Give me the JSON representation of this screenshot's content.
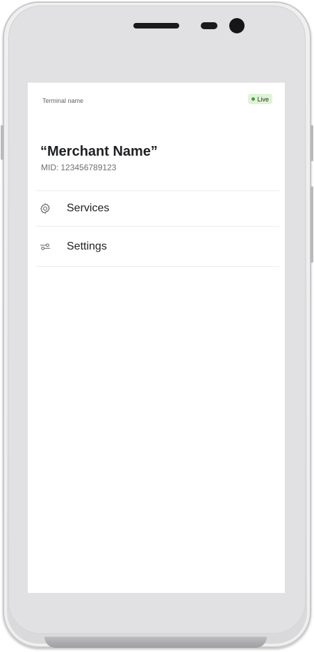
{
  "header": {
    "terminal_name": "Terminal name",
    "status_badge": "Live"
  },
  "merchant": {
    "name": "“Merchant Name”",
    "mid_label": "MID:",
    "mid_value": "123456789123"
  },
  "menu": {
    "items": [
      {
        "label": "Services",
        "icon": "gear-icon"
      },
      {
        "label": "Settings",
        "icon": "sliders-icon"
      }
    ]
  },
  "colors": {
    "live_badge_bg": "#dff3d6",
    "live_dot": "#4a9a3a",
    "screen_bg": "#ffffff",
    "text_primary": "#202124",
    "text_secondary": "#6b6f73"
  }
}
